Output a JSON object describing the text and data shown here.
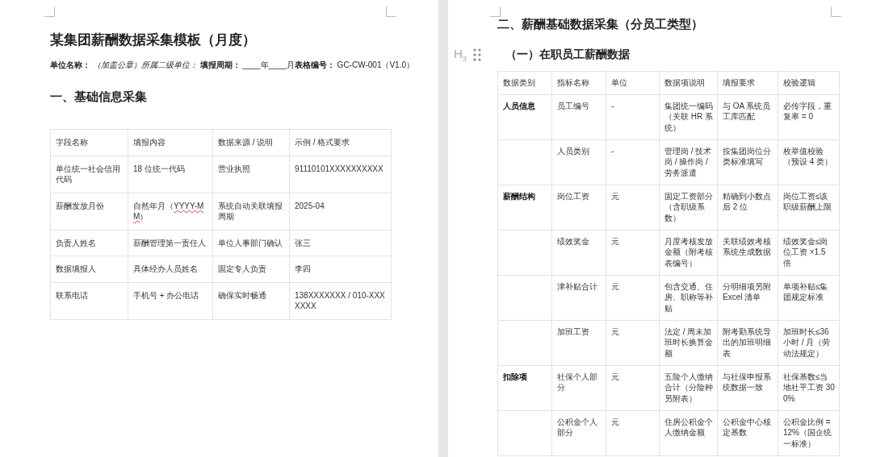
{
  "left_page": {
    "title": "某集团薪酬数据采集模板（月度）",
    "meta": "**单位名称：** *（加盖公章）所属二级单位：* **填报周期：** ____年____月**表格编号：** GC-CW-001（V1.0）",
    "section_heading": "一、基础信息采集",
    "table": {
      "columns": [
        "字段名称",
        "填报内容",
        "数据来源 / 说明",
        "示例 / 格式要求"
      ],
      "rows": [
        [
          "单位统一社会信用代码",
          "18 位统一代码",
          "营业执照",
          "91110101XXXXXXXXXX"
        ],
        [
          "薪酬发放月份",
          {
            "segments": [
              {
                "text": "自然年月（",
                "misspelled": false
              },
              {
                "text": "YYYY-MM",
                "misspelled": true
              },
              {
                "text": "）",
                "misspelled": false
              }
            ]
          },
          "系统自动关联填报周期",
          "2025-04"
        ],
        [
          "负责人姓名",
          "薪酬管理第一责任人",
          "单位人事部门确认",
          "张三"
        ],
        [
          "数据填报人",
          "具体经办人员姓名",
          "固定专人负责",
          "李四"
        ],
        [
          "联系电话",
          "手机号 + 办公电话",
          "确保实时畅通",
          "138XXXXXXX / 010-XXXXXXX"
        ]
      ]
    }
  },
  "right_page": {
    "section_heading": "二、薪酬基础数据采集（分员工类型）",
    "heading_marker": "H$_{3}$",
    "subheading": "（一）在职员工薪酬数据",
    "table": {
      "columns": [
        "数据类别",
        "指标名称",
        "单位",
        "数据项说明",
        "填报要求",
        "校验逻辑"
      ],
      "groups": [
        {
          "category": "人员信息",
          "rows": [
            [
              "员工编号",
              "-",
              "集团统一编码（关联 HR 系统）",
              "与 OA 系统员工库匹配",
              "必传字段，重复率 = 0"
            ],
            [
              "人员类别",
              "-",
              "管理岗 / 技术岗 / 操作岗 / 劳务派遣",
              "按集团岗位分类标准填写",
              "枚举值校验（预设 4 类）"
            ]
          ]
        },
        {
          "category": "薪酬结构",
          "rows": [
            [
              "岗位工资",
              "元",
              "固定工资部分（含职级系数）",
              "精确到小数点后 2 位",
              "岗位工资≤该职级薪酬上限"
            ],
            [
              "绩效奖金",
              "元",
              "月度考核发放金额（附考核表编号）",
              "关联绩效考核系统生成数据",
              "绩效奖金≤岗位工资 ×1.5 倍"
            ],
            [
              "津补贴合计",
              "元",
              "包含交通、住房、职称等补贴",
              "分明细项另附 Excel 清单",
              "单项补贴≤集团规定标准"
            ],
            [
              "加班工资",
              "元",
              "法定 / 周末加班时长换算金额",
              "附考勤系统导出的加班明细表",
              "加班时长≤36 小时 / 月（劳动法规定）"
            ]
          ]
        },
        {
          "category": "扣除项",
          "rows": [
            [
              "社保个人部分",
              "元",
              "五险个人缴纳合计（分险种另附表）",
              "与社保申报系统数据一致",
              "社保基数≤当地社平工资 300%"
            ],
            [
              "公积金个人部分",
              "元",
              "住房公积金个人缴纳金额",
              "公积金中心核定基数",
              "公积金比例 = 12%（国企统一标准）"
            ]
          ]
        }
      ]
    }
  }
}
